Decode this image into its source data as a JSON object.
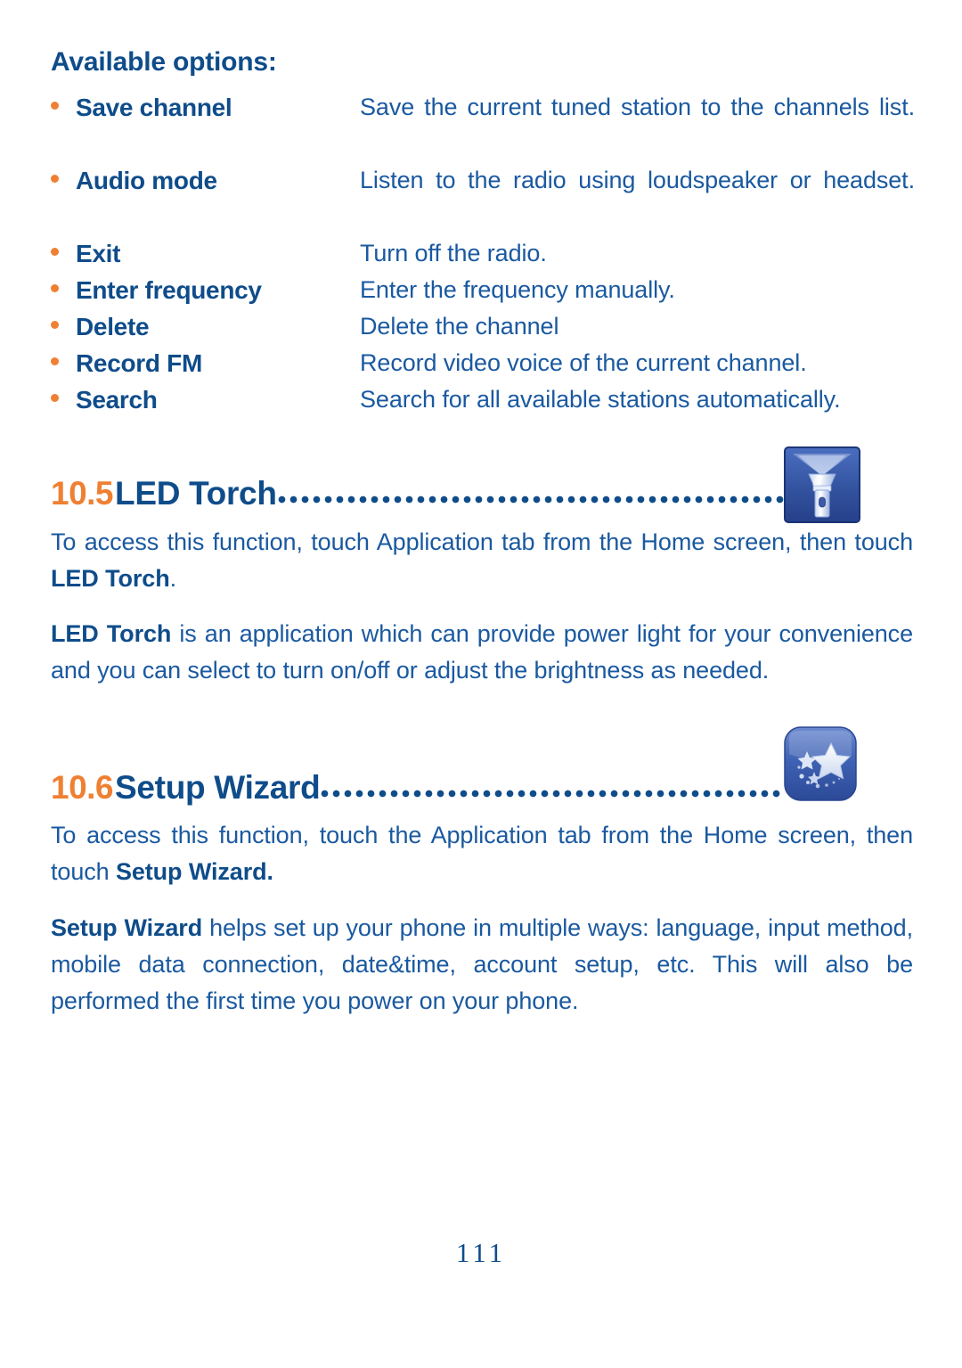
{
  "document": {
    "page_number": "111"
  },
  "options_section": {
    "heading": "Available options:",
    "items": [
      {
        "label": "Save channel",
        "description": "Save the current tuned station to the channels list."
      },
      {
        "label": "Audio mode",
        "description": "Listen to the radio using loudspeaker or headset."
      },
      {
        "label": "Exit",
        "description": "Turn off the radio."
      },
      {
        "label": "Enter frequency",
        "description": "Enter the frequency manually."
      },
      {
        "label": "Delete",
        "description": "Delete the channel"
      },
      {
        "label": "Record FM",
        "description": "Record video voice of the current channel."
      },
      {
        "label": "Search",
        "description": "Search for all available stations automatically."
      }
    ]
  },
  "sections": [
    {
      "number": "10.5",
      "title": "LED Torch",
      "icon": "led-torch-icon",
      "paragraph_1_prefix": "To access this function, touch Application tab from the Home screen, then touch ",
      "paragraph_1_bold": "LED Torch",
      "paragraph_1_suffix": ".",
      "paragraph_2_bold": "LED Torch",
      "paragraph_2_rest": " is an application which can provide power light for your convenience and you can select to turn on/off or adjust the brightness as needed."
    },
    {
      "number": "10.6",
      "title": "Setup Wizard",
      "icon": "setup-wizard-icon",
      "paragraph_1_prefix": "To access this function, touch the Application tab from the Home screen, then touch ",
      "paragraph_1_bold": "Setup Wizard.",
      "paragraph_1_suffix": "",
      "paragraph_2_bold": "Setup Wizard",
      "paragraph_2_rest": " helps set up your phone in multiple ways: language, input method, mobile data connection, date&time, account setup, etc. This will also be performed the first time you power on your phone."
    }
  ],
  "colors": {
    "heading_blue": "#0f4c8a",
    "body_blue": "#1a59a0",
    "accent_orange": "#ef8033",
    "icon_bg_blue": "#2b4f9e"
  }
}
